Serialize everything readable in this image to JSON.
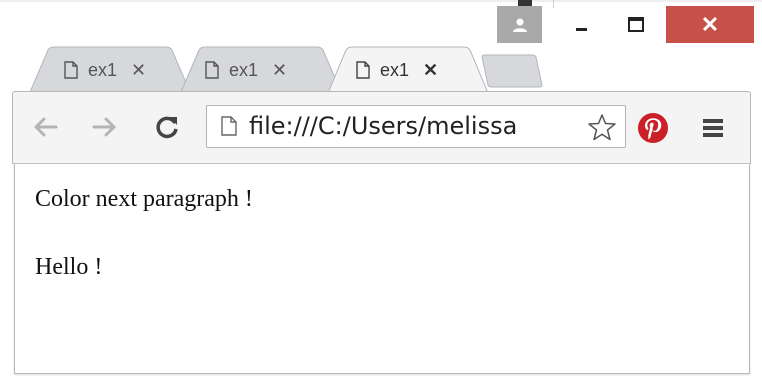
{
  "tabs": [
    {
      "label": "ex1",
      "close": "✕",
      "active": false
    },
    {
      "label": "ex1",
      "close": "✕",
      "active": false
    },
    {
      "label": "ex1",
      "close": "✕",
      "active": true
    }
  ],
  "caption": {
    "close": "✕"
  },
  "toolbar": {
    "back": "←",
    "forward": "→",
    "address": "file:///C:/Users/melissa"
  },
  "page": {
    "paragraphs": [
      "Color next paragraph !",
      "Hello !"
    ]
  },
  "icons": {
    "file": "file-icon",
    "star": "star-icon",
    "pinterest": "pinterest-icon",
    "menu": "hamburger-menu-icon",
    "profile": "user-profile-icon",
    "reload": "reload-icon"
  },
  "colors": {
    "close_button": "#c7504a",
    "pinterest": "#cb2027",
    "profile_button": "#a9a9a9"
  }
}
